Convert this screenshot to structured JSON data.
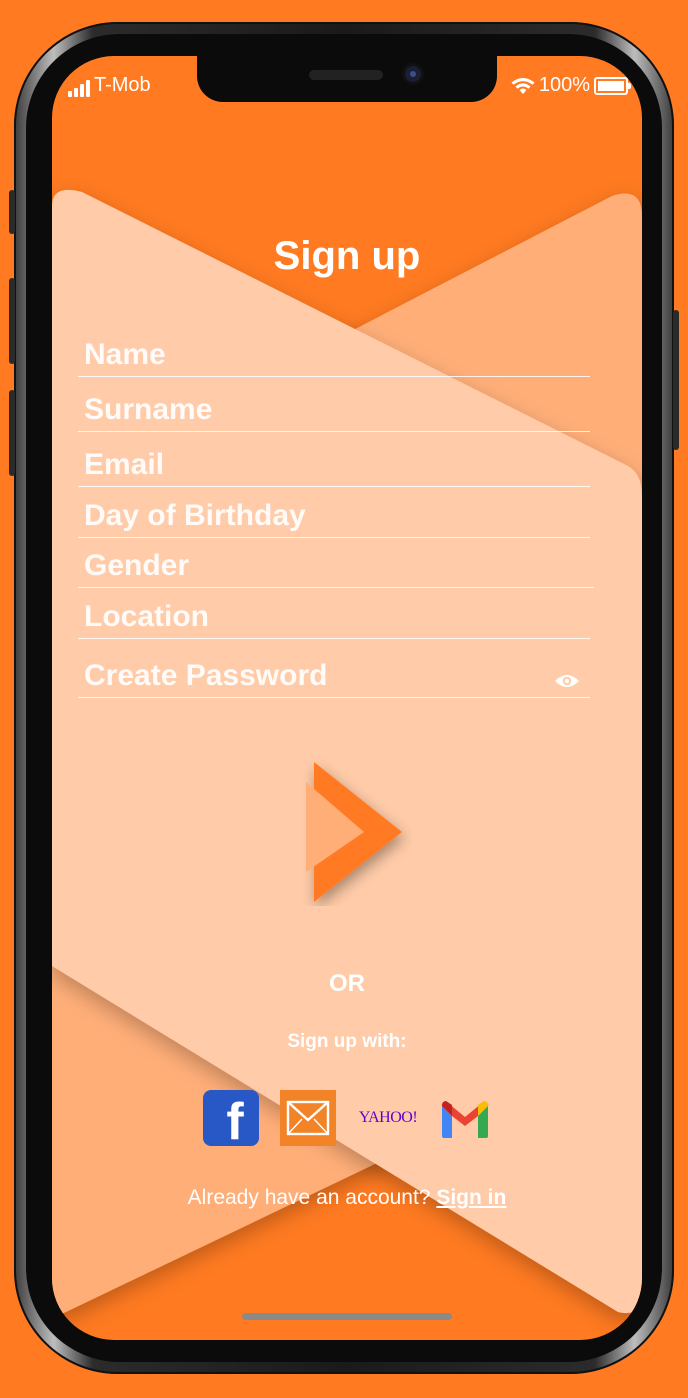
{
  "status_bar": {
    "carrier": "T-Mob",
    "battery": "100%"
  },
  "form": {
    "title": "Sign up",
    "fields": {
      "name": "Name",
      "surname": "Surname",
      "email": "Email",
      "birthday": "Day of Birthday",
      "gender": "Gender",
      "location": "Location",
      "password": "Create Password"
    }
  },
  "social": {
    "or_label": "OR",
    "signup_with": "Sign up with:",
    "providers": {
      "facebook_letter": "f",
      "yahoo": "YAHOO!"
    }
  },
  "footer": {
    "prompt": "Already have an account?",
    "link": "Sign in"
  },
  "colors": {
    "brand_orange": "#FF7A21",
    "card_light": "#FFCBA8",
    "card_mid": "#FFAE78"
  },
  "icons": {
    "password_toggle": "eye-icon",
    "submit": "play-arrow-icon"
  }
}
